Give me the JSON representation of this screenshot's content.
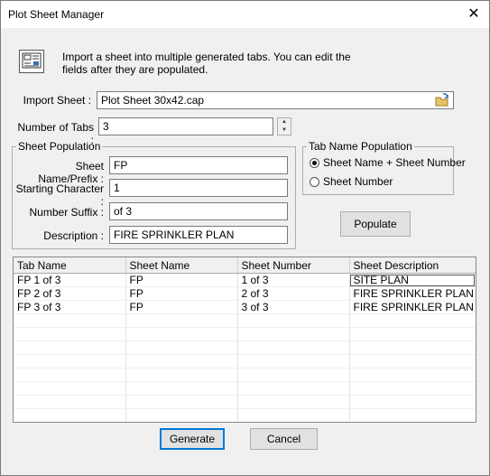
{
  "window": {
    "title": "Plot Sheet Manager",
    "close_label": "✕"
  },
  "description": "Import a sheet into multiple generated tabs. You can edit the fields after they are populated.",
  "import_sheet": {
    "label": "Import Sheet :",
    "value": "Plot Sheet 30x42.cap",
    "browse_icon": "folder-open-icon"
  },
  "number_of_tabs": {
    "label": "Number of Tabs :",
    "value": "3"
  },
  "sheet_population": {
    "legend": "Sheet Population",
    "name_prefix": {
      "label": "Sheet Name/Prefix :",
      "value": "FP"
    },
    "starting_character": {
      "label": "Starting Character :",
      "value": "1"
    },
    "number_suffix": {
      "label": "Number Suffix :",
      "value": "of 3"
    },
    "description": {
      "label": "Description :",
      "value": "FIRE SPRINKLER PLAN"
    }
  },
  "tab_name_population": {
    "legend": "Tab Name Population",
    "options": [
      {
        "label": "Sheet Name + Sheet Number",
        "selected": true
      },
      {
        "label": "Sheet Number",
        "selected": false
      }
    ]
  },
  "populate_label": "Populate",
  "grid": {
    "columns": [
      "Tab Name",
      "Sheet Name",
      "Sheet Number",
      "Sheet Description"
    ],
    "rows": [
      [
        "FP 1 of 3",
        "FP",
        "1 of 3",
        "SITE PLAN"
      ],
      [
        "FP 2 of 3",
        "FP",
        "2 of 3",
        "FIRE SPRINKLER PLAN"
      ],
      [
        "FP 3 of 3",
        "FP",
        "3 of 3",
        "FIRE SPRINKLER PLAN"
      ]
    ]
  },
  "generate_label": "Generate",
  "cancel_label": "Cancel"
}
